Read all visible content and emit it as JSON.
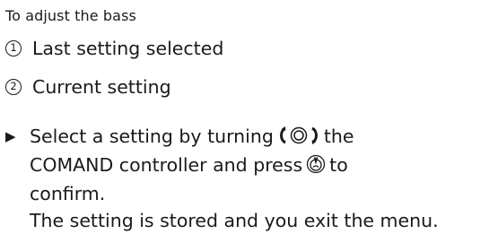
{
  "heading": "To adjust the bass",
  "legend": [
    {
      "marker": "1",
      "label": "Last setting selected"
    },
    {
      "marker": "2",
      "label": "Current setting"
    }
  ],
  "instruction": {
    "bullet": "▶",
    "line1_before": "Select a setting by turning",
    "line1_after": "the",
    "line2_before": "COMAND controller and press",
    "line2_after": "to",
    "line3": "confirm."
  },
  "result": "The setting is stored and you exit the menu.",
  "icons": {
    "turn_controller": "turn-controller-icon",
    "press_controller": "press-controller-icon"
  }
}
